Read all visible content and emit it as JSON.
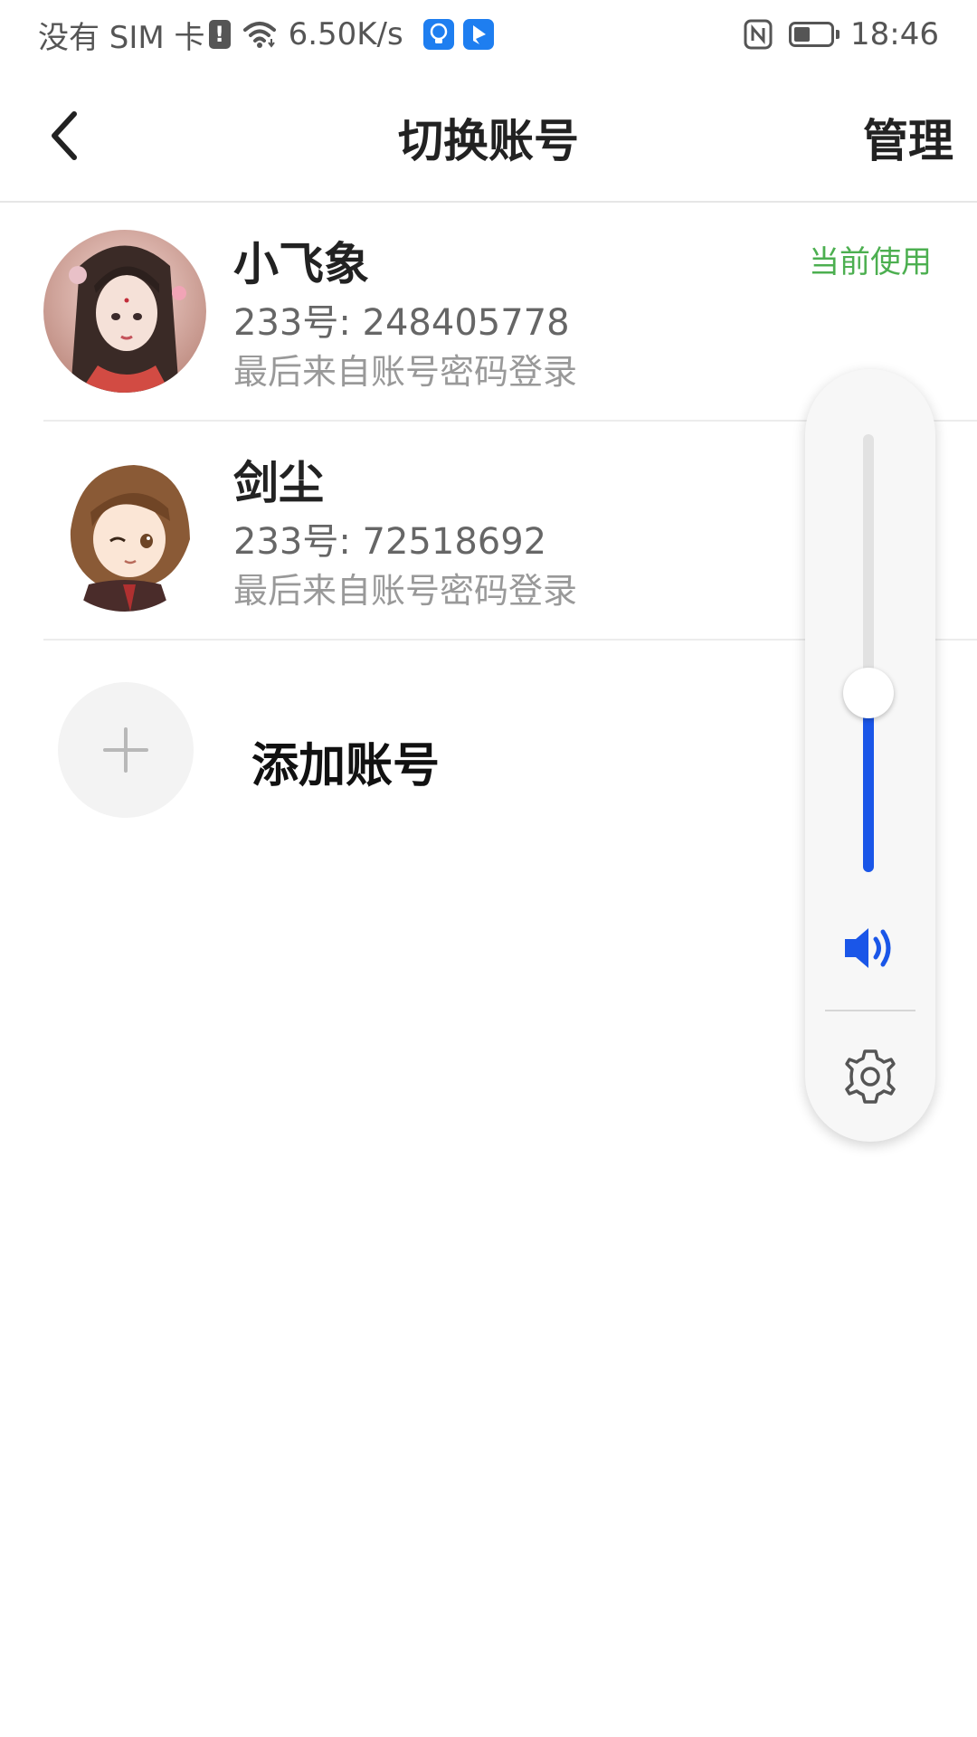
{
  "status_bar": {
    "carrier": "没有 SIM 卡",
    "sim_alert": "!",
    "net_speed": "6.50K/s",
    "time": "18:46",
    "battery_level": 0.45,
    "icons": [
      "sim-alert-icon",
      "wifi-icon",
      "bulb-app-icon",
      "bird-app-icon",
      "nfc-icon",
      "battery-icon"
    ]
  },
  "header": {
    "back_icon": "chevron-left-icon",
    "title": "切换账号",
    "manage_label": "管理"
  },
  "accounts": [
    {
      "name": "小飞象",
      "id_text": "233号: 248405778",
      "login_text": "最后来自账号密码登录",
      "current_label": "当前使用",
      "is_current": true
    },
    {
      "name": "剑尘",
      "id_text": "233号: 72518692",
      "login_text": "最后来自账号密码登录",
      "current_label": "",
      "is_current": false
    }
  ],
  "add_account": {
    "icon": "plus-icon",
    "label": "添加账号"
  },
  "volume_panel": {
    "level": 0.41,
    "accent_color": "#1a56e8",
    "speaker_icon": "speaker-icon",
    "settings_icon": "gear-icon"
  },
  "colors": {
    "current_badge": "#4caf50",
    "volume_fill": "#1a56e8",
    "wifi_blue": "#1e7ef0"
  }
}
